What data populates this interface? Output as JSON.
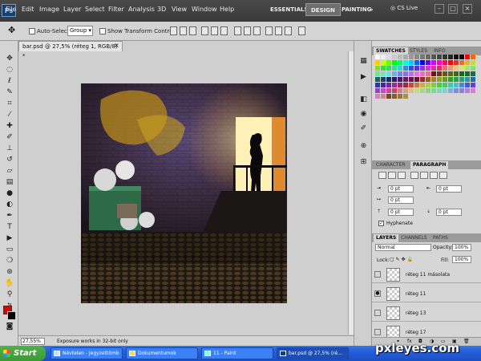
{
  "app": {
    "logo": "Ps",
    "zoom": "27,5",
    "cs_live": "CS Live"
  },
  "menu": [
    "File",
    "Edit",
    "Image",
    "Layer",
    "Select",
    "Filter",
    "Analysis",
    "3D",
    "View",
    "Window",
    "Help"
  ],
  "workspaces": [
    "ESSENTIALS",
    "DESIGN",
    "PAINTING"
  ],
  "workspace_more": "»",
  "options": {
    "auto_select": "Auto-Select:",
    "auto_select_value": "Group",
    "show_transform": "Show Transform Controls"
  },
  "document": {
    "tab_title": "bar.psd @ 27,5% (réteg 1, RGB/8) *",
    "close": "×"
  },
  "status": {
    "zoom": "27,55%",
    "message": "Exposure works in 32-bit only"
  },
  "swatches_tabs": [
    "SWATCHES",
    "STYLES",
    "INFO"
  ],
  "character_tabs": [
    "CHARACTER",
    "PARAGRAPH"
  ],
  "paragraph": {
    "indent_left": "0 pt",
    "indent_right": "0 pt",
    "first_line": "0 pt",
    "space_before": "0 pt",
    "space_after": "0 pt",
    "hyphenate": "Hyphenate"
  },
  "layers_tabs": [
    "LAYERS",
    "CHANNELS",
    "PATHS"
  ],
  "layers_panel": {
    "blend_mode": "Normal",
    "opacity_label": "Opacity:",
    "opacity": "100%",
    "lock_label": "Lock:",
    "fill_label": "Fill:",
    "fill": "100%"
  },
  "layers": [
    "réteg 11 másolata",
    "réteg 11",
    "réteg 13",
    "réteg 17"
  ],
  "taskbar": {
    "start": "Start",
    "items": [
      "Névtelen - Jegyzettömb",
      "Dokumentumok",
      "11 - Paint",
      "bar.psd @ 27,5% (ré..."
    ]
  },
  "watermark": "pxleyes.com",
  "colors": {
    "foreground": "#e10000",
    "background": "#000000"
  }
}
